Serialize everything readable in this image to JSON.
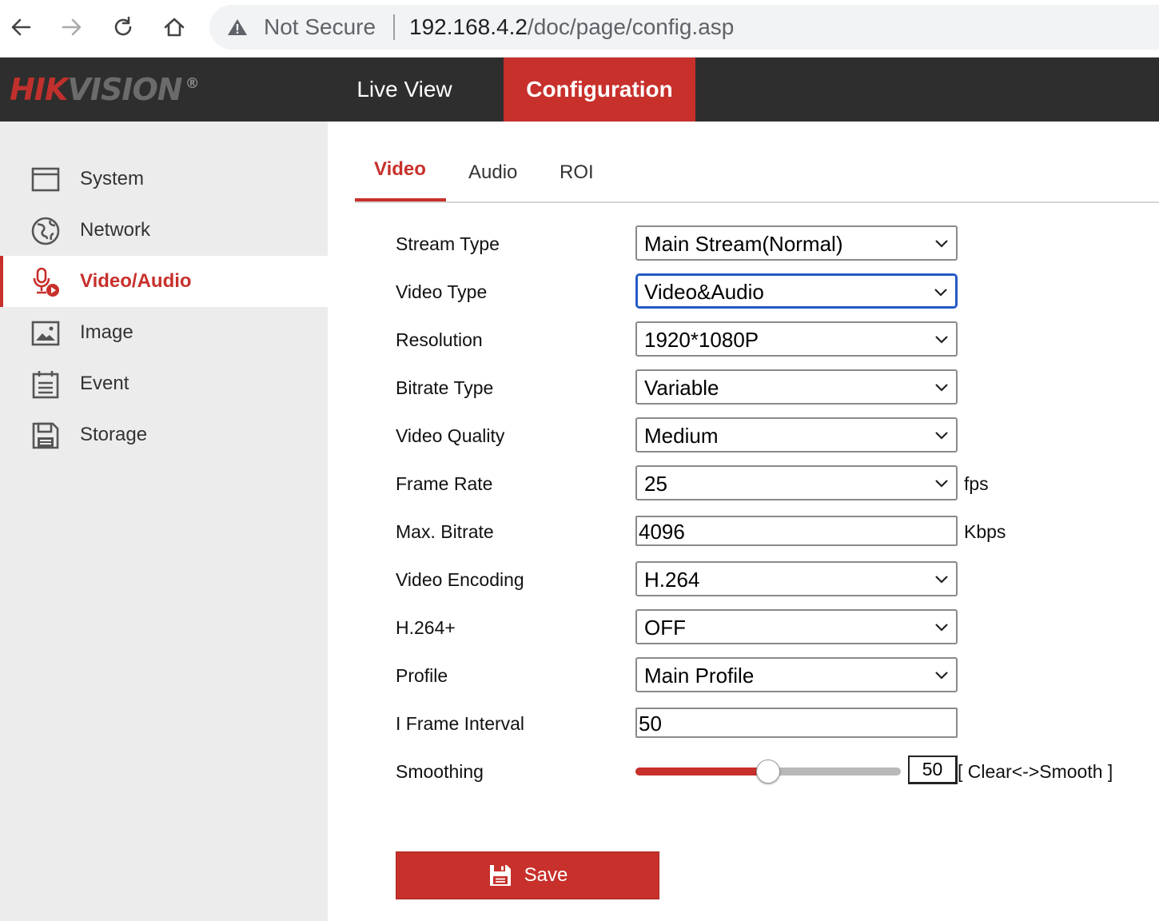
{
  "browser": {
    "security_label": "Not Secure",
    "url_host": "192.168.4.2",
    "url_path": "/doc/page/config.asp"
  },
  "header": {
    "logo_main": "HIK",
    "logo_second": "VISION",
    "logo_reg": "®",
    "tabs": [
      {
        "label": "Live View",
        "active": false
      },
      {
        "label": "Configuration",
        "active": true
      }
    ]
  },
  "sidebar": {
    "items": [
      {
        "label": "System",
        "icon": "window-icon",
        "active": false
      },
      {
        "label": "Network",
        "icon": "globe-icon",
        "active": false
      },
      {
        "label": "Video/Audio",
        "icon": "mic-video-icon",
        "active": true
      },
      {
        "label": "Image",
        "icon": "picture-icon",
        "active": false
      },
      {
        "label": "Event",
        "icon": "calendar-icon",
        "active": false
      },
      {
        "label": "Storage",
        "icon": "disk-icon",
        "active": false
      }
    ]
  },
  "subtabs": [
    {
      "label": "Video",
      "active": true
    },
    {
      "label": "Audio",
      "active": false
    },
    {
      "label": "ROI",
      "active": false
    }
  ],
  "form": {
    "stream_type": {
      "label": "Stream Type",
      "value": "Main Stream(Normal)"
    },
    "video_type": {
      "label": "Video Type",
      "value": "Video&Audio"
    },
    "resolution": {
      "label": "Resolution",
      "value": "1920*1080P"
    },
    "bitrate_type": {
      "label": "Bitrate Type",
      "value": "Variable"
    },
    "video_quality": {
      "label": "Video Quality",
      "value": "Medium"
    },
    "frame_rate": {
      "label": "Frame Rate",
      "value": "25",
      "unit": "fps"
    },
    "max_bitrate": {
      "label": "Max. Bitrate",
      "value": "4096",
      "unit": "Kbps"
    },
    "video_encoding": {
      "label": "Video Encoding",
      "value": "H.264"
    },
    "h264_plus": {
      "label": "H.264+",
      "value": "OFF"
    },
    "profile": {
      "label": "Profile",
      "value": "Main Profile"
    },
    "i_frame_interval": {
      "label": "I Frame Interval",
      "value": "50"
    },
    "smoothing": {
      "label": "Smoothing",
      "value": "50",
      "min": 0,
      "max": 100,
      "hint": "[ Clear<->Smooth ]"
    }
  },
  "save": {
    "label": "Save"
  },
  "colors": {
    "accent": "#c7302b",
    "header_bg": "#2e2e2e",
    "sidebar_bg": "#ececec",
    "focus": "#2559c6"
  }
}
